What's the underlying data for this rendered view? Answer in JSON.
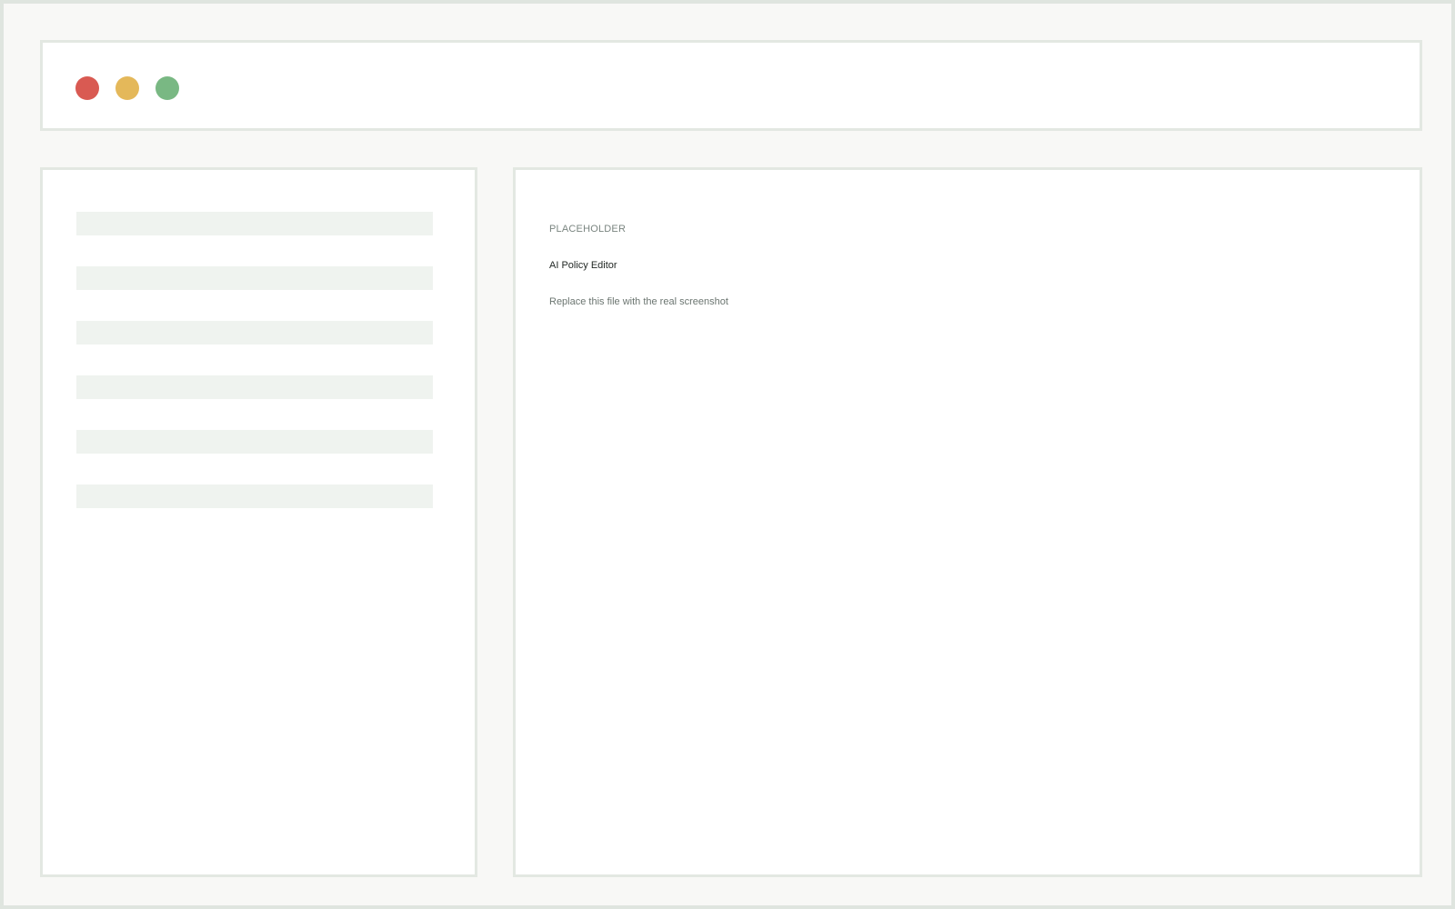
{
  "window": {
    "controls": [
      {
        "name": "close",
        "color": "#d95a52"
      },
      {
        "name": "minimize",
        "color": "#e4b85a"
      },
      {
        "name": "maximize",
        "color": "#79b883"
      }
    ]
  },
  "sidebar": {
    "placeholder_rows": 6
  },
  "main": {
    "kicker": "PLACEHOLDER",
    "title": "AI Policy Editor",
    "subtitle": "Replace this file with the real screenshot"
  },
  "colors": {
    "page_background": "#f8f8f6",
    "panel_background": "#ffffff",
    "panel_border": "#e3e8e2",
    "skeleton": "#eff3ef"
  }
}
